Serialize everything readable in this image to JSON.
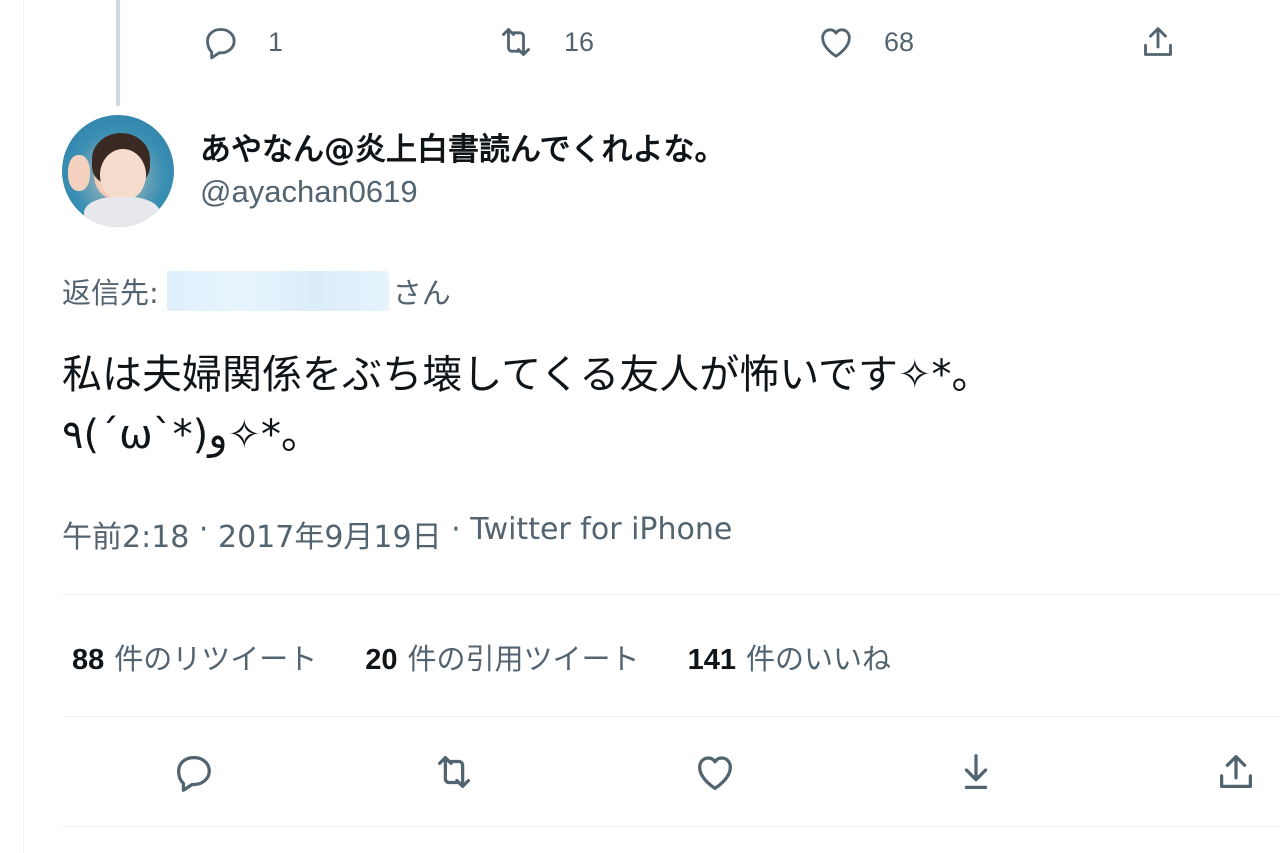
{
  "previous_tweet": {
    "actions": {
      "reply_count": "1",
      "retweet_count": "16",
      "like_count": "68"
    }
  },
  "tweet": {
    "author": {
      "display_name": "あやなん@炎上白書読んでくれよな。",
      "handle": "@ayachan0619"
    },
    "reply_to": {
      "prefix": "返信先:",
      "suffix": "さん"
    },
    "text_line1": "私は夫婦関係をぶち壊してくる友人が怖いです✧*。",
    "text_line2": "٩(ˊωˋ*)و✧*。",
    "time": "午前2:18",
    "separator": " · ",
    "date": "2017年9月19日",
    "source": "Twitter for iPhone",
    "stats": {
      "retweets_num": "88",
      "retweets_label": "件のリツイート",
      "quotes_num": "20",
      "quotes_label": "件の引用ツイート",
      "likes_num": "141",
      "likes_label": "件のいいね"
    }
  },
  "colors": {
    "text_primary": "#0f1419",
    "text_secondary": "#536471",
    "divider": "#eff3f4",
    "thread_line": "#cfd9de"
  },
  "icons": [
    "reply-icon",
    "retweet-icon",
    "like-icon",
    "share-icon",
    "bookmark-icon"
  ]
}
